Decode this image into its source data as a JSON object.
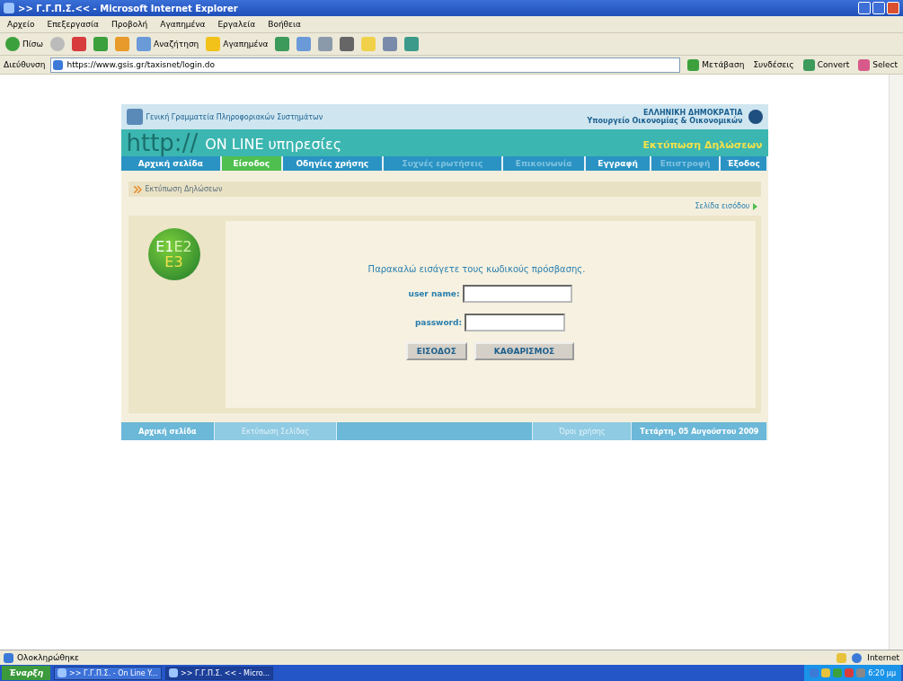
{
  "window": {
    "title": ">> Γ.Γ.Π.Σ.<< - Microsoft Internet Explorer"
  },
  "menu": [
    "Αρχείο",
    "Επεξεργασία",
    "Προβολή",
    "Αγαπημένα",
    "Εργαλεία",
    "Βοήθεια"
  ],
  "toolbar": [
    {
      "kind": "back",
      "label": "Πίσω"
    },
    {
      "kind": "forward"
    },
    {
      "kind": "stop"
    },
    {
      "kind": "refresh"
    },
    {
      "kind": "home"
    },
    {
      "kind": "search",
      "label": "Αναζήτηση"
    },
    {
      "kind": "favorites",
      "label": "Αγαπημένα"
    },
    {
      "kind": "history"
    },
    {
      "kind": "mail"
    },
    {
      "kind": "print"
    },
    {
      "kind": "edit"
    },
    {
      "kind": "folder"
    },
    {
      "kind": "research"
    },
    {
      "kind": "messenger"
    }
  ],
  "address": {
    "label": "Διεύθυνση",
    "url": "https://www.gsis.gr/taxisnet/login.do",
    "go": "Μετάβαση",
    "links": "Συνδέσεις",
    "convert": "Convert",
    "select": "Select"
  },
  "header": {
    "org": "Γενική Γραμματεία Πληροφοριακών Συστημάτων",
    "country": "ΕΛΛΗΝΙΚΗ ΔΗΜΟΚΡΑΤΙΑ",
    "ministry": "Υπουργείο Οικονομίας & Οικονομικών",
    "brand": "http://",
    "brand_sub": "ON LINE υπηρεσίες",
    "service": "Εκτύπωση Δηλώσεων"
  },
  "nav": [
    {
      "label": "Αρχική σελίδα",
      "selected": false,
      "disabled": false
    },
    {
      "label": "Είσοδος",
      "selected": true,
      "disabled": false
    },
    {
      "label": "Οδηγίες χρήσης",
      "selected": false,
      "disabled": false
    },
    {
      "label": "Συχνές ερωτήσεις",
      "selected": false,
      "disabled": true
    },
    {
      "label": "Επικοινωνία",
      "selected": false,
      "disabled": true
    },
    {
      "label": "Εγγραφή",
      "selected": false,
      "disabled": false
    },
    {
      "label": "Επιστροφή",
      "selected": false,
      "disabled": true
    },
    {
      "label": "Έξοδος",
      "selected": false,
      "disabled": false
    }
  ],
  "breadcrumb": "Εκτύπωση Δηλώσεων",
  "home_link": "Σελίδα εισόδου",
  "badge": {
    "top_left": "E1",
    "top_right": "E2",
    "bottom": "E3"
  },
  "login": {
    "prompt": "Παρακαλώ εισάγετε τους κωδικούς πρόσβασης.",
    "username_label": "user name:",
    "password_label": "password:",
    "submit": "ΕΙΣΟΔΟΣ",
    "reset": "ΚΑΘΑΡΙΣΜΟΣ"
  },
  "footer": [
    {
      "kind": "link",
      "label": "Αρχική σελίδα",
      "disabled": false
    },
    {
      "kind": "link",
      "label": "Εκτύπωση Σελίδας",
      "disabled": true
    },
    {
      "kind": "spacer"
    },
    {
      "kind": "link",
      "label": "Όροι χρήσης",
      "disabled": true
    },
    {
      "kind": "link",
      "label": "Τετάρτη, 05 Αυγούστου 2009",
      "disabled": false
    }
  ],
  "status_bar": {
    "text": "Ολοκληρώθηκε",
    "zone": "Internet"
  },
  "taskbar": {
    "start": "Έναρξη",
    "tasks": [
      {
        "label": ">> Γ.Γ.Π.Σ. - On Line Y...",
        "selected": false
      },
      {
        "label": ">> Γ.Γ.Π.Σ. << - Micro...",
        "selected": true
      }
    ],
    "clock": "6:20 μμ"
  }
}
